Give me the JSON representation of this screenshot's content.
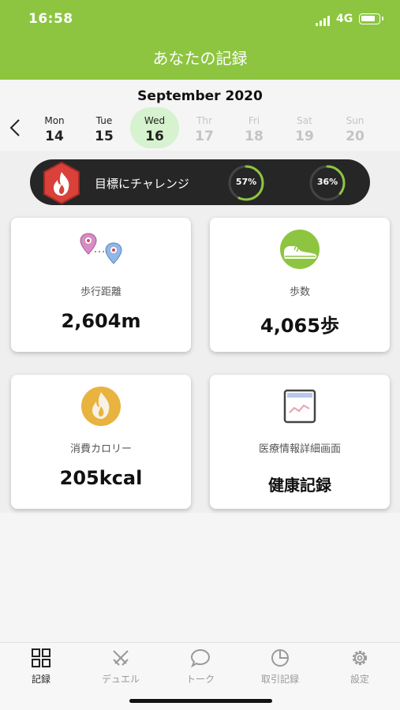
{
  "status_bar": {
    "time": "16:58",
    "network": "4G",
    "battery_level": 0.85
  },
  "header": {
    "title": "あなたの記録"
  },
  "calendar": {
    "month_title": "September 2020",
    "days": [
      {
        "name": "Mon",
        "num": "14",
        "state": "past"
      },
      {
        "name": "Tue",
        "num": "15",
        "state": "past"
      },
      {
        "name": "Wed",
        "num": "16",
        "state": "selected"
      },
      {
        "name": "Thr",
        "num": "17",
        "state": "future"
      },
      {
        "name": "Fri",
        "num": "18",
        "state": "future"
      },
      {
        "name": "Sat",
        "num": "19",
        "state": "future"
      },
      {
        "name": "Sun",
        "num": "20",
        "state": "future"
      }
    ]
  },
  "challenge": {
    "label": "目標にチャレンジ",
    "progress": [
      {
        "text": "57%",
        "value": 0.57,
        "color": "#8dc540"
      },
      {
        "text": "36%",
        "value": 0.36,
        "color": "#8dc540"
      }
    ],
    "icon": "flame-icon",
    "icon_color": "#d9413a"
  },
  "cards": [
    {
      "label": "歩行距離",
      "value": "2,604m",
      "icon": "map-pins-icon"
    },
    {
      "label": "歩数",
      "value": "4,065歩",
      "icon": "sneaker-icon"
    },
    {
      "label": "消費カロリー",
      "value": "205kcal",
      "icon": "fire-icon"
    },
    {
      "label": "医療情報詳細画面",
      "value": "健康記録",
      "icon": "health-chart-icon"
    }
  ],
  "tabs": [
    {
      "label": "記録",
      "icon": "grid-icon",
      "active": true
    },
    {
      "label": "デュエル",
      "icon": "swords-icon",
      "active": false
    },
    {
      "label": "トーク",
      "icon": "chat-bubble-icon",
      "active": false
    },
    {
      "label": "取引記録",
      "icon": "pie-chart-icon",
      "active": false
    },
    {
      "label": "設定",
      "icon": "gear-icon",
      "active": false
    }
  ],
  "colors": {
    "accent": "#8dc540",
    "selected_day": "#d6f2cf",
    "challenge_bar": "#262626"
  }
}
